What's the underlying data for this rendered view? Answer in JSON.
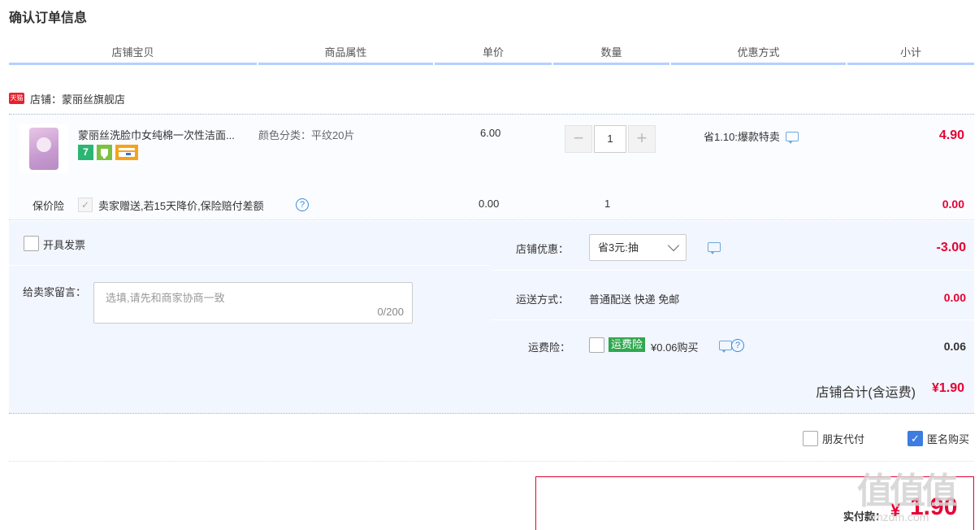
{
  "page_title": "确认订单信息",
  "columns": [
    "店铺宝贝",
    "商品属性",
    "单价",
    "数量",
    "优惠方式",
    "小计"
  ],
  "shop": {
    "icon": "tmall-icon",
    "icon_text": "天猫",
    "label": "店铺：蒙丽丝旗舰店"
  },
  "item": {
    "name": "蒙丽丝洗脸巾女纯棉一次性洁面...",
    "badges": [
      "7",
      "",
      ""
    ],
    "attribute": "颜色分类：平纹20片",
    "price": "6.00",
    "qty_minus": "−",
    "qty": "1",
    "qty_plus": "+",
    "promo": "省1.10:爆款特卖",
    "subtotal": "4.90"
  },
  "insurance": {
    "label": "保价险",
    "check": "✓",
    "text": "卖家赠送,若15天降价,保险赔付差额",
    "help": "?",
    "price": "0.00",
    "qty": "1",
    "subtotal": "0.00"
  },
  "invoice": {
    "label": "开具发票",
    "checked": false
  },
  "message": {
    "label": "给卖家留言：",
    "placeholder": "选填,请先和商家协商一致",
    "count": "0/200"
  },
  "shop_discount": {
    "label": "店铺优惠：",
    "selected": "省3元:抽",
    "value": "-3.00"
  },
  "shipping": {
    "label": "运送方式：",
    "method": "普通配送 快递 免邮",
    "value": "0.00"
  },
  "freight_insurance": {
    "label": "运费险：",
    "tag": "运费险",
    "price_text": "¥0.06购买",
    "help": "?",
    "value": "0.06"
  },
  "shop_total": {
    "label": "店铺合计(含运费)",
    "value": "¥1.90"
  },
  "options": {
    "friend_pay": "朋友代付",
    "anonymous": "匿名购买",
    "anonymous_checked": true,
    "check": "✓"
  },
  "payment": {
    "label": "实付款：",
    "currency": "¥",
    "amount": "1.90"
  },
  "watermark": {
    "main": "值值值",
    "sub": "smzdm.com"
  },
  "colors": {
    "accent_red": "#e60033",
    "header_line": "#b2d1ff",
    "panel_bg": "#f2f6fe",
    "check_blue": "#3d7ce0"
  }
}
